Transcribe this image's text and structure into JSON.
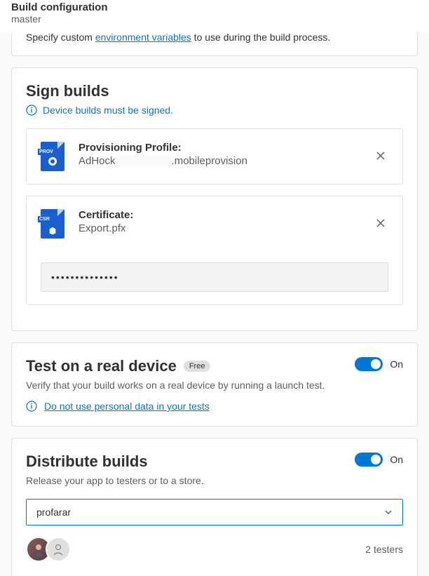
{
  "header": {
    "title": "Build configuration",
    "branch": "master"
  },
  "env_section": {
    "prefix": "Specify custom ",
    "link": "environment variables",
    "suffix": " to use during the build process."
  },
  "sign": {
    "title": "Sign builds",
    "info": "Device builds must be signed.",
    "profile_label": "Provisioning Profile:",
    "profile_prefix": "AdHock",
    "profile_suffix": ".mobileprovision",
    "cert_label": "Certificate:",
    "cert_name": "Export.pfx",
    "password_value": "••••••••••••••"
  },
  "test": {
    "title": "Test on a real device",
    "badge": "Free",
    "toggle": "On",
    "subtitle": "Verify that your build works on a real device by running a launch test.",
    "info_link": "Do not use personal data in your tests"
  },
  "distribute": {
    "title": "Distribute builds",
    "toggle": "On",
    "subtitle": "Release your app to testers or to a store.",
    "selected": "profarar",
    "testers": "2 testers"
  }
}
